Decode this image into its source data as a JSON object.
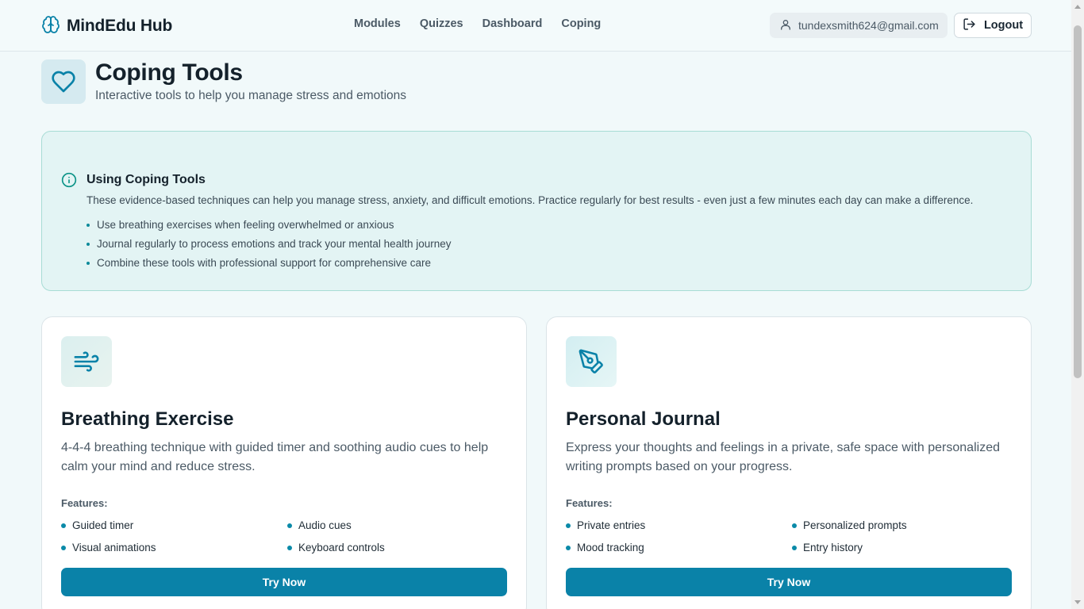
{
  "header": {
    "brand": "MindEdu Hub",
    "brand_icon": "brain-icon",
    "nav": [
      "Modules",
      "Quizzes",
      "Dashboard",
      "Coping"
    ],
    "user_email": "tundexsmith624@gmail.com",
    "user_icon": "user-icon",
    "logout_label": "Logout",
    "logout_icon": "logout-icon"
  },
  "page": {
    "title": "Coping Tools",
    "subtitle": "Interactive tools to help you manage stress and emotions",
    "icon": "heart-icon"
  },
  "info": {
    "icon": "info-icon",
    "title": "Using Coping Tools",
    "description": "These evidence-based techniques can help you manage stress, anxiety, and difficult emotions. Practice regularly for best results - even just a few minutes each day can make a difference.",
    "tips": [
      "Use breathing exercises when feeling overwhelmed or anxious",
      "Journal regularly to process emotions and track your mental health journey",
      "Combine these tools with professional support for comprehensive care"
    ]
  },
  "cards": [
    {
      "icon": "wind-icon",
      "title": "Breathing Exercise",
      "description": "4-4-4 breathing technique with guided timer and soothing audio cues to help calm your mind and reduce stress.",
      "features_label": "Features:",
      "features": [
        "Guided timer",
        "Audio cues",
        "Visual animations",
        "Keyboard controls"
      ],
      "button": "Try Now"
    },
    {
      "icon": "pen-tool-icon",
      "title": "Personal Journal",
      "description": "Express your thoughts and feelings in a private, safe space with personalized writing prompts based on your progress.",
      "features_label": "Features:",
      "features": [
        "Private entries",
        "Personalized prompts",
        "Mood tracking",
        "Entry history"
      ],
      "button": "Try Now"
    }
  ],
  "colors": {
    "accent": "#0a82a8",
    "background": "#f1f9fa",
    "info_bg": "#e3f4f4",
    "info_border": "#a8dcd5"
  }
}
